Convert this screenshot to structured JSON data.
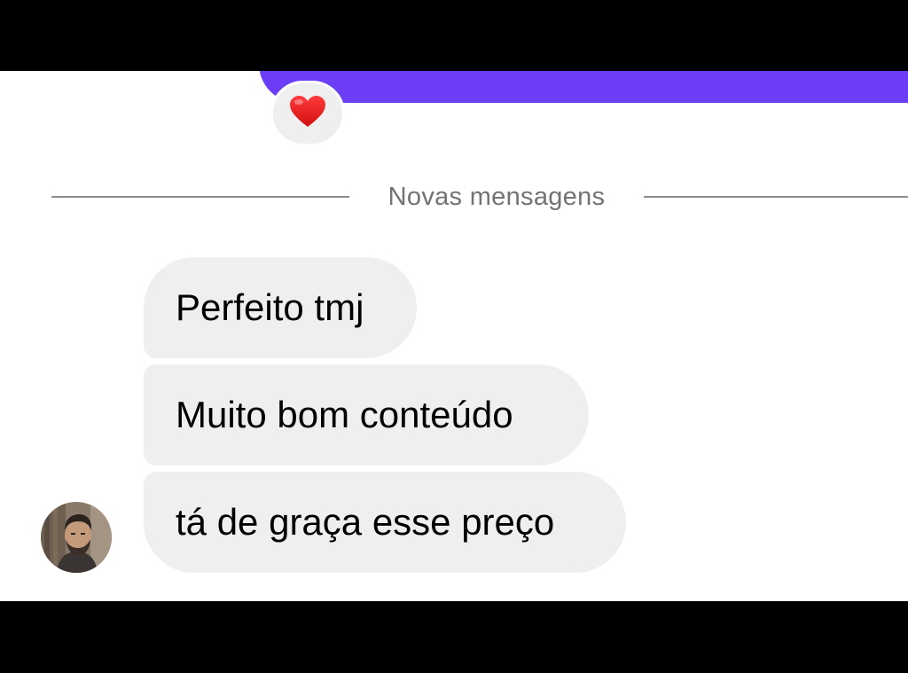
{
  "thread": {
    "reaction_emoji": "❤️",
    "divider_label": "Novas mensagens",
    "messages": [
      {
        "text": "Perfeito tmj"
      },
      {
        "text": "Muito bom conteúdo"
      },
      {
        "text": "tá de graça esse preço"
      }
    ]
  },
  "colors": {
    "sent_bubble": "#6b3df5",
    "received_bubble": "#efefef",
    "divider_text": "#737373"
  },
  "icons": {
    "reaction": "heart-icon",
    "avatar": "user-avatar"
  }
}
